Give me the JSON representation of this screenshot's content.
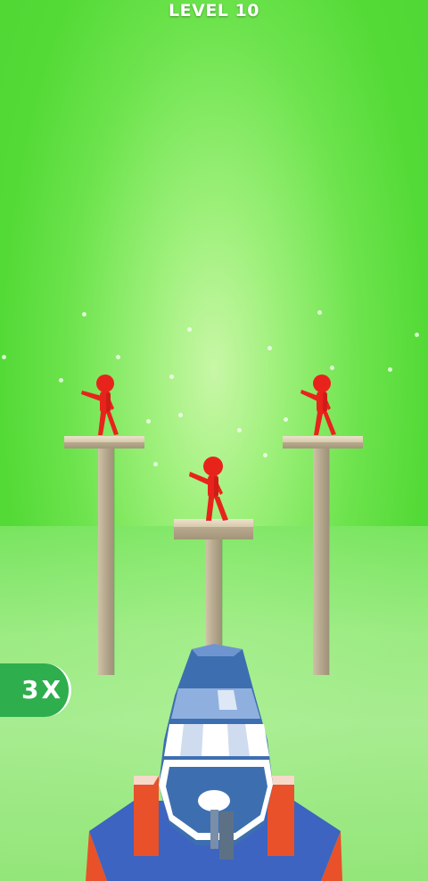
{
  "hud": {
    "level_label": "LEVEL 10"
  },
  "powerup": {
    "multiplier_label": "3X"
  },
  "colors": {
    "background_green": "#5ddb3f",
    "enemy_red": "#e8231c",
    "multiplier_green": "#2fae4e",
    "cannon_blue": "#3d6fb0",
    "base_orange": "#e8512a"
  },
  "icons": {
    "cannon": "cannon-icon",
    "enemy": "stickman-icon"
  }
}
